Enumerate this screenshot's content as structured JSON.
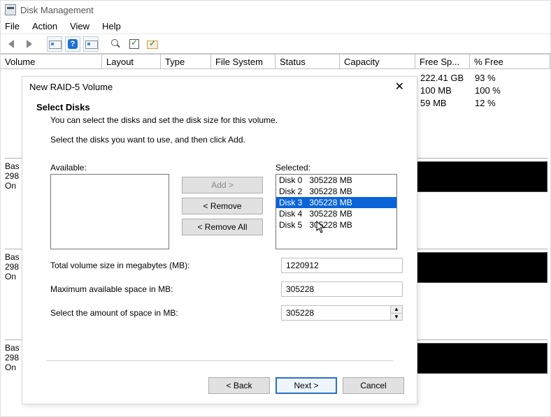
{
  "app": {
    "title": "Disk Management"
  },
  "menu": {
    "file": "File",
    "action": "Action",
    "view": "View",
    "help": "Help"
  },
  "columns": {
    "volume": "Volume",
    "layout": "Layout",
    "type": "Type",
    "fs": "File System",
    "status": "Status",
    "capacity": "Capacity",
    "free": "Free Sp...",
    "pct": "% Free"
  },
  "bg_rows": [
    {
      "free": "222.41 GB",
      "pct": "93 %"
    },
    {
      "free": "100 MB",
      "pct": "100 %"
    },
    {
      "free": "59 MB",
      "pct": "12 %"
    }
  ],
  "disk_panel": {
    "row0": {
      "l1": "Bas",
      "l2": "298",
      "l3": "On"
    },
    "row1": {
      "l1": "Bas",
      "l2": "298",
      "l3": "On"
    },
    "row2": {
      "l1": "Bas",
      "l2": "298",
      "l3": "On"
    }
  },
  "dialog": {
    "title": "New RAID-5 Volume",
    "heading": "Select Disks",
    "subtitle": "You can select the disks and set the disk size for this volume.",
    "instruction": "Select the disks you want to use, and then click Add.",
    "available_label": "Available:",
    "selected_label": "Selected:",
    "add": "Add >",
    "remove": "< Remove",
    "remove_all": "< Remove All",
    "selected": [
      {
        "name": "Disk 0",
        "size": "305228 MB"
      },
      {
        "name": "Disk 2",
        "size": "305228 MB"
      },
      {
        "name": "Disk 3",
        "size": "305228 MB"
      },
      {
        "name": "Disk 4",
        "size": "305228 MB"
      },
      {
        "name": "Disk 5",
        "size": "305228 MB"
      }
    ],
    "selected_index": 2,
    "total_label": "Total volume size in megabytes (MB):",
    "total_value": "1220912",
    "max_label": "Maximum available space in MB:",
    "max_value": "305228",
    "amount_label": "Select the amount of space in MB:",
    "amount_value": "305228",
    "back": "< Back",
    "next": "Next >",
    "cancel": "Cancel"
  }
}
